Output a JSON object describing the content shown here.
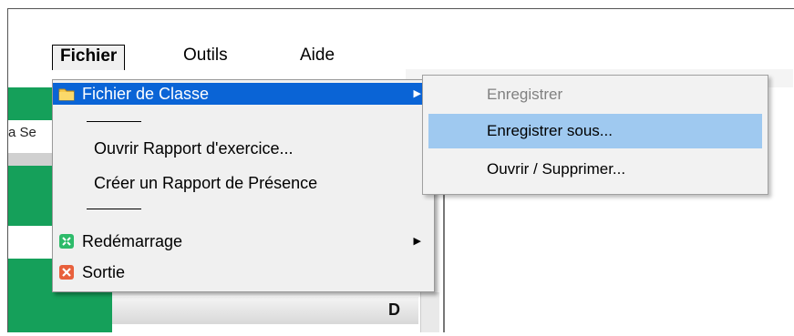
{
  "menubar": {
    "items": [
      {
        "label": "Fichier",
        "active": true
      },
      {
        "label": "Outils",
        "active": false
      },
      {
        "label": "Aide",
        "active": false
      }
    ]
  },
  "background": {
    "partial_label": "a Se",
    "table_header_letter": "D",
    "accent_color": "#15a05a"
  },
  "file_menu": {
    "items": [
      {
        "label": "Fichier de Classe",
        "icon": "folder-icon",
        "has_submenu": true,
        "highlighted": true
      },
      {
        "label": "Ouvrir Rapport d'exercice..."
      },
      {
        "label": "Créer un Rapport de Présence"
      },
      {
        "label": "Redémarrage",
        "icon": "restart-icon",
        "has_submenu": true
      },
      {
        "label": "Sortie",
        "icon": "exit-icon"
      }
    ],
    "highlight_color": "#0a64d6"
  },
  "submenu": {
    "items": [
      {
        "label": "Enregistrer",
        "disabled": true
      },
      {
        "label": "Enregistrer sous...",
        "hovered": true
      },
      {
        "label": "Ouvrir / Supprimer..."
      }
    ],
    "hover_color": "#9fc9f0"
  }
}
